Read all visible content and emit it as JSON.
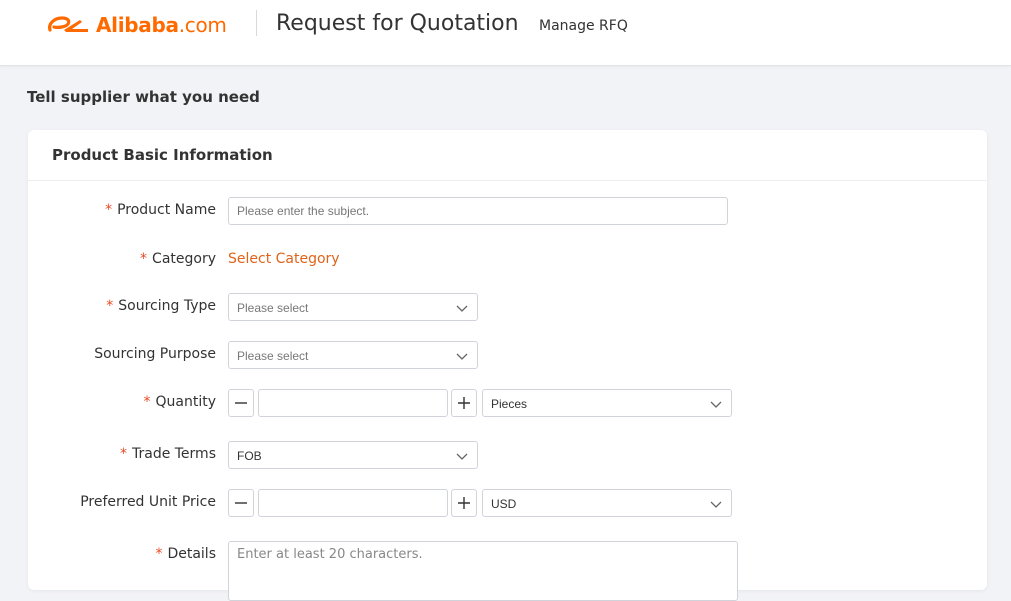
{
  "header": {
    "logo_brand": "Alibaba",
    "logo_suffix": ".com",
    "title": "Request for Quotation",
    "manage_link": "Manage RFQ"
  },
  "section_heading": "Tell supplier what you need",
  "card": {
    "title": "Product Basic Information"
  },
  "form": {
    "required_mark": "*",
    "product_name": {
      "label": "Product Name",
      "placeholder": "Please enter the subject.",
      "value": ""
    },
    "category": {
      "label": "Category",
      "link": "Select Category"
    },
    "sourcing_type": {
      "label": "Sourcing Type",
      "value": "Please select"
    },
    "sourcing_purpose": {
      "label": "Sourcing Purpose",
      "value": "Please select"
    },
    "quantity": {
      "label": "Quantity",
      "value": "",
      "minus": "−",
      "plus": "+",
      "unit": "Pieces"
    },
    "trade_terms": {
      "label": "Trade Terms",
      "value": "FOB"
    },
    "preferred_unit_price": {
      "label": "Preferred Unit Price",
      "value": "",
      "minus": "−",
      "plus": "+",
      "currency": "USD"
    },
    "details": {
      "label": "Details",
      "placeholder": "Enter at least 20 characters."
    }
  },
  "colors": {
    "brand_orange": "#ff6a00",
    "link_orange": "#e0631a",
    "required_red": "#e84a24"
  }
}
